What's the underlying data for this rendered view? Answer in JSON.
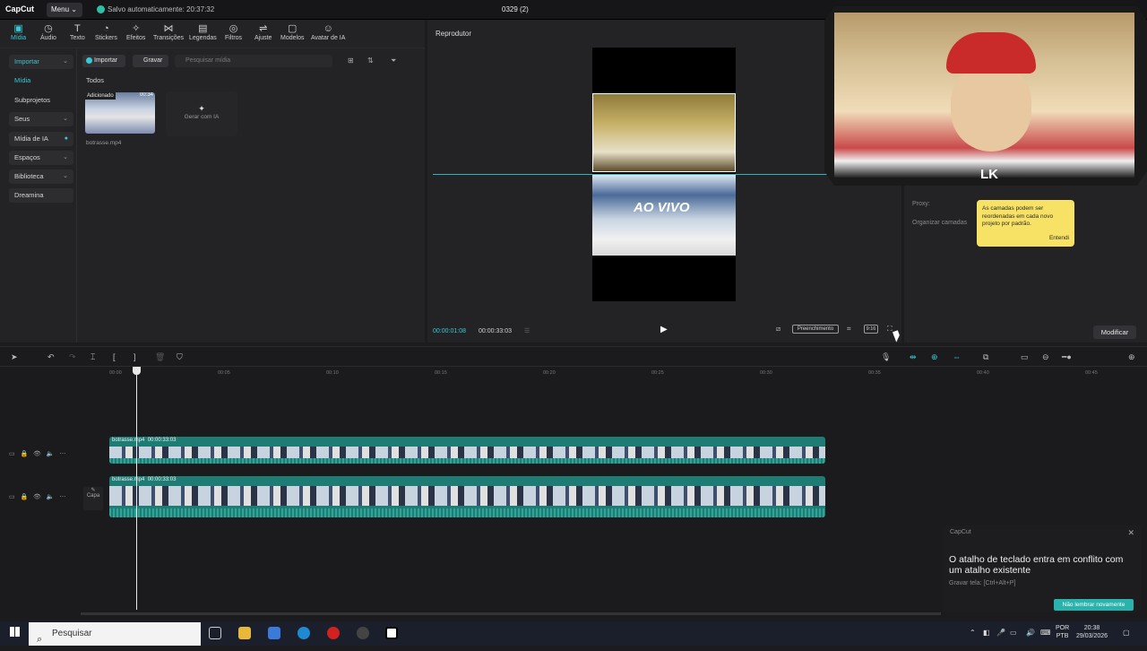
{
  "titlebar": {
    "logo": "CapCut",
    "menu": "Menu",
    "autosave": "Salvo automaticamente: 20:37:32",
    "project": "0329 (2)"
  },
  "toolbar": {
    "items": [
      {
        "label": "Mídia",
        "icon": "media-icon"
      },
      {
        "label": "Áudio",
        "icon": "audio-icon"
      },
      {
        "label": "Texto",
        "icon": "text-icon"
      },
      {
        "label": "Stickers",
        "icon": "sticker-icon"
      },
      {
        "label": "Efeitos",
        "icon": "effects-icon"
      },
      {
        "label": "Transições",
        "icon": "transition-icon"
      },
      {
        "label": "Legendas",
        "icon": "captions-icon"
      },
      {
        "label": "Filtros",
        "icon": "filter-icon"
      },
      {
        "label": "Ajuste",
        "icon": "adjust-icon"
      },
      {
        "label": "Modelos",
        "icon": "templates-icon"
      },
      {
        "label": "Avatar de IA",
        "icon": "avatar-icon"
      }
    ]
  },
  "sidebar": {
    "items": [
      "Importar",
      "Mídia",
      "Subprojetos",
      "Seus",
      "Mídia de IA",
      "Espaços",
      "Biblioteca",
      "Dreamina"
    ]
  },
  "media": {
    "import_btn": "Importar",
    "record_btn": "Gravar",
    "search_placeholder": "Pesquisar mídia",
    "filter_label": "Todos",
    "thumb_tag": "Adicionado",
    "thumb_duration": "00:34",
    "thumb_name": "botrasse.mp4",
    "generate_label": "Gerar com IA"
  },
  "player": {
    "title": "Reprodutor",
    "video_text": "AO VIVO",
    "current_time": "00:00:01:08",
    "total_time": "00:00:33:03",
    "fill_label": "Preenchimento",
    "ratio_label": "9:16"
  },
  "rightpanel": {
    "proxy": "Proxy:",
    "organize": "Organizar camadas",
    "tooltip_text": "As camadas podem ser reordenadas em cada novo projeto por padrão.",
    "tooltip_ok": "Entendi",
    "modify_btn": "Modificar"
  },
  "webcam": {
    "overlay_text": "LK"
  },
  "timeline": {
    "ruler": [
      "00:00",
      "00:05",
      "00:10",
      "00:15",
      "00:20",
      "00:25",
      "00:30",
      "00:35",
      "00:40",
      "00:45"
    ],
    "clips": [
      {
        "name": "botrasse.mp4",
        "duration": "00:00:33:03"
      },
      {
        "name": "botrasse.mp4",
        "duration": "00:00:33:03"
      }
    ],
    "cover_label": "Capa"
  },
  "notification": {
    "app": "CapCut",
    "title": "O atalho de teclado entra em conflito com um atalho existente",
    "subtitle": "Gravar tela: [Ctrl+Alt+P]",
    "button": "Não lembrar novamente"
  },
  "taskbar": {
    "search": "Pesquisar",
    "lang1": "POR",
    "lang2": "PTB",
    "time": "20:38",
    "date": "29/03/2026"
  },
  "colors": {
    "accent": "#39c9d4",
    "clip": "#1e7c74",
    "tooltip": "#f7e266"
  }
}
